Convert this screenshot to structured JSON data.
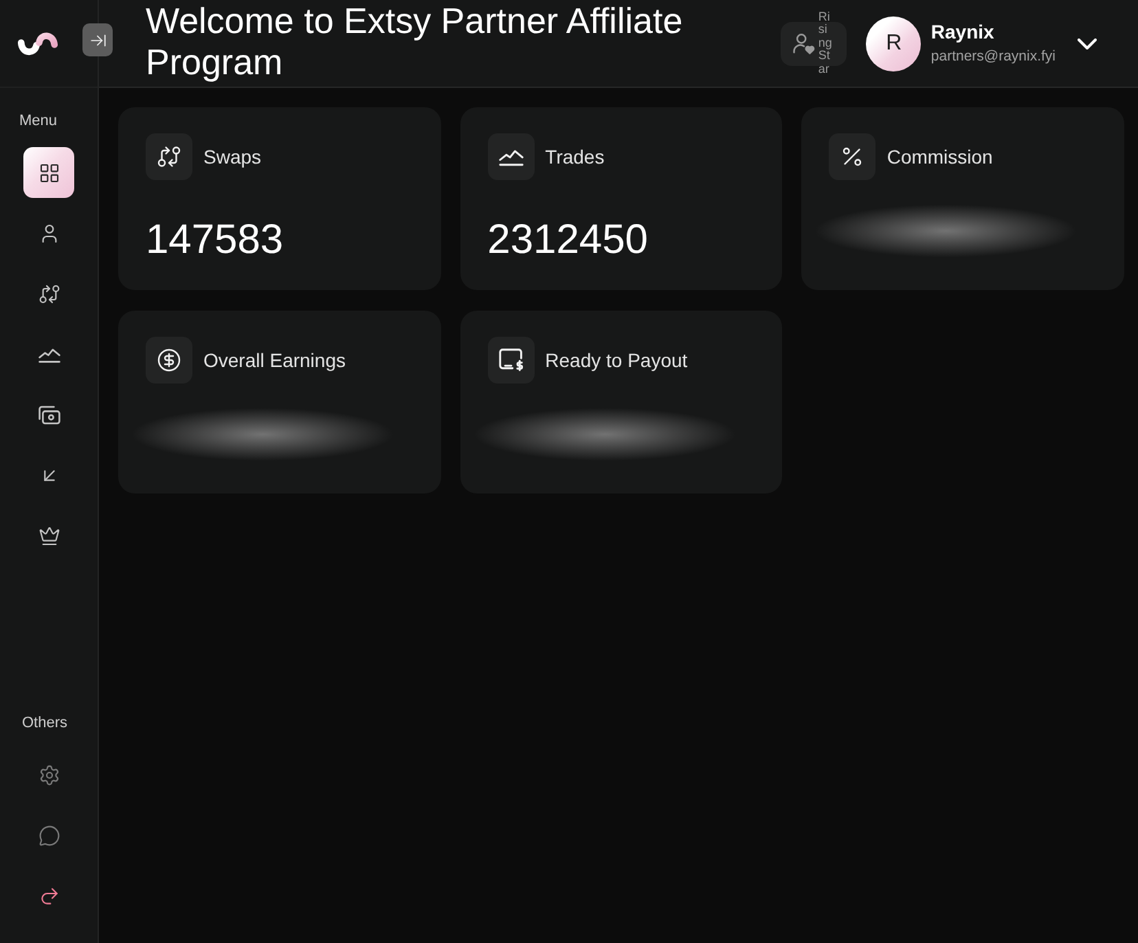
{
  "sidebar": {
    "sections": [
      {
        "label": "Menu",
        "items": [
          {
            "selected": true
          },
          {
            "selected": false
          },
          {
            "selected": false
          },
          {
            "selected": false
          },
          {
            "selected": false
          },
          {
            "selected": false
          },
          {
            "selected": false
          }
        ]
      },
      {
        "label": "Others",
        "items": [
          {
            "selected": false
          },
          {
            "selected": false
          },
          {
            "selected": false
          }
        ]
      }
    ]
  },
  "header": {
    "title": "Welcome to Extsy Partner Affiliate Program",
    "badge": {
      "label": "Rising Star"
    },
    "user": {
      "initial": "R",
      "name": "Raynix",
      "email": "partners@raynix.fyi"
    }
  },
  "cards": [
    {
      "label": "Swaps",
      "value": "147583",
      "blurred": false
    },
    {
      "label": "Trades",
      "value": "2312450",
      "blurred": false
    },
    {
      "label": "Commission",
      "blurred": true
    },
    {
      "label": "Overall Earnings",
      "blurred": true
    },
    {
      "label": "Ready to Payout",
      "blurred": true
    }
  ]
}
